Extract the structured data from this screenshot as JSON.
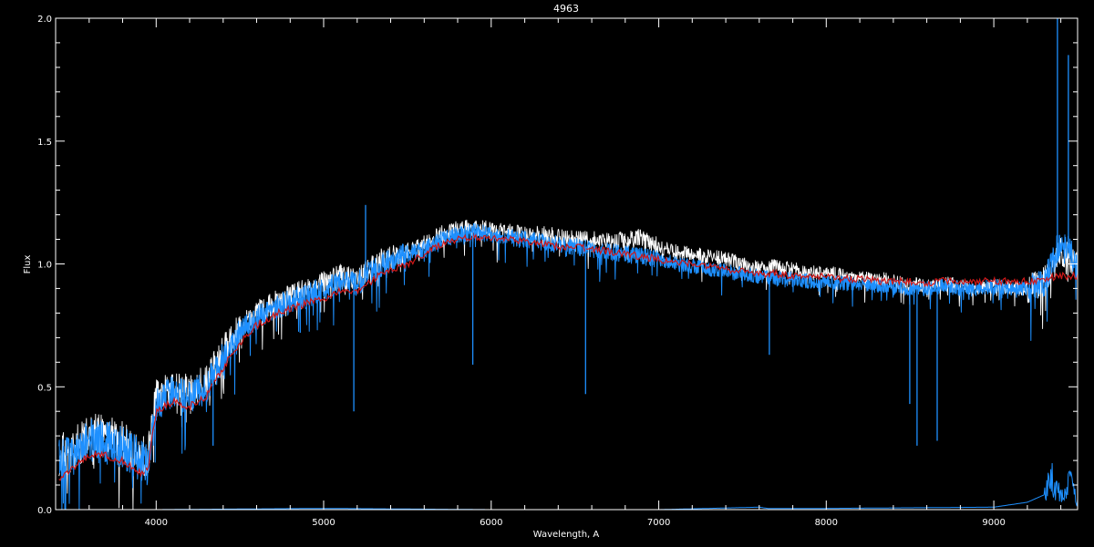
{
  "chart_data": {
    "type": "line",
    "title": "4963",
    "xlabel": "Wavelength, A",
    "ylabel": "Flux",
    "xlim": [
      3400,
      9500
    ],
    "ylim": [
      0.0,
      2.0
    ],
    "xticks": [
      4000,
      5000,
      6000,
      7000,
      8000,
      9000
    ],
    "xtick_labels": [
      "4000",
      "5000",
      "6000",
      "7000",
      "8000",
      "9000"
    ],
    "yticks": [
      0.0,
      0.5,
      1.0,
      1.5,
      2.0
    ],
    "ytick_labels": [
      "0.0",
      "0.5",
      "1.0",
      "1.5",
      "2.0"
    ],
    "grid": false,
    "background": "#000000",
    "series": [
      {
        "color": "#ffffff",
        "style": "spectrum-white",
        "x": [
          3420,
          3500,
          3600,
          3700,
          3800,
          3900,
          3950,
          4000,
          4100,
          4200,
          4300,
          4400,
          4500,
          4600,
          4700,
          4800,
          4900,
          5000,
          5100,
          5200,
          5300,
          5400,
          5500,
          5600,
          5700,
          5800,
          5900,
          6000,
          6100,
          6200,
          6300,
          6400,
          6500,
          6600,
          6700,
          6800,
          6900,
          7000,
          7100,
          7200,
          7300,
          7400,
          7500,
          7600,
          7700,
          7800,
          7900,
          8000,
          8100,
          8200,
          8300,
          8400,
          8500,
          8600,
          8700,
          8800,
          8900,
          9000,
          9100,
          9200,
          9300,
          9400,
          9500
        ],
        "values": [
          0.22,
          0.24,
          0.3,
          0.3,
          0.28,
          0.22,
          0.2,
          0.46,
          0.5,
          0.48,
          0.52,
          0.64,
          0.74,
          0.8,
          0.84,
          0.87,
          0.89,
          0.92,
          0.95,
          0.93,
          1.0,
          1.03,
          1.05,
          1.08,
          1.12,
          1.14,
          1.15,
          1.14,
          1.13,
          1.12,
          1.12,
          1.11,
          1.1,
          1.1,
          1.09,
          1.1,
          1.11,
          1.07,
          1.05,
          1.04,
          1.03,
          1.02,
          1.0,
          0.98,
          0.99,
          0.98,
          0.96,
          0.97,
          0.95,
          0.94,
          0.94,
          0.93,
          0.92,
          0.91,
          0.92,
          0.91,
          0.9,
          0.91,
          0.9,
          0.9,
          0.93,
          1.05,
          1.0
        ]
      },
      {
        "color": "#1e90ff",
        "style": "spectrum-blue",
        "x": [
          3420,
          3500,
          3600,
          3700,
          3800,
          3900,
          3950,
          4000,
          4100,
          4200,
          4300,
          4400,
          4500,
          4600,
          4700,
          4800,
          4900,
          5000,
          5100,
          5200,
          5300,
          5400,
          5500,
          5600,
          5700,
          5800,
          5900,
          6000,
          6100,
          6200,
          6300,
          6400,
          6500,
          6600,
          6700,
          6800,
          6900,
          7000,
          7100,
          7200,
          7300,
          7400,
          7500,
          7600,
          7700,
          7800,
          7900,
          8000,
          8100,
          8200,
          8300,
          8400,
          8500,
          8600,
          8700,
          8800,
          8900,
          9000,
          9100,
          9200,
          9300,
          9400,
          9500
        ],
        "values": [
          0.2,
          0.22,
          0.28,
          0.27,
          0.26,
          0.2,
          0.18,
          0.43,
          0.48,
          0.46,
          0.5,
          0.62,
          0.72,
          0.78,
          0.82,
          0.85,
          0.87,
          0.9,
          0.93,
          0.92,
          0.98,
          1.01,
          1.04,
          1.06,
          1.1,
          1.12,
          1.13,
          1.12,
          1.11,
          1.1,
          1.09,
          1.08,
          1.07,
          1.06,
          1.05,
          1.04,
          1.03,
          1.02,
          1.0,
          0.99,
          0.98,
          0.97,
          0.96,
          0.95,
          0.94,
          0.94,
          0.93,
          0.93,
          0.92,
          0.92,
          0.91,
          0.91,
          0.9,
          0.9,
          0.91,
          0.9,
          0.9,
          0.91,
          0.9,
          0.9,
          0.92,
          1.1,
          1.0
        ]
      },
      {
        "color": "#d01818",
        "style": "model",
        "x": [
          3420,
          3500,
          3600,
          3700,
          3800,
          3900,
          3950,
          4000,
          4100,
          4200,
          4300,
          4400,
          4500,
          4600,
          4700,
          4800,
          4900,
          5000,
          5100,
          5200,
          5300,
          5400,
          5500,
          5600,
          5700,
          5800,
          5900,
          6000,
          6100,
          6200,
          6300,
          6400,
          6500,
          6600,
          6700,
          6800,
          6900,
          7000,
          7100,
          7200,
          7300,
          7400,
          7500,
          7600,
          7700,
          7800,
          7900,
          8000,
          8100,
          8200,
          8300,
          8400,
          8500,
          8600,
          8700,
          8800,
          8900,
          9000,
          9100,
          9200,
          9300,
          9400,
          9500
        ],
        "values": [
          0.12,
          0.17,
          0.22,
          0.22,
          0.2,
          0.15,
          0.16,
          0.4,
          0.44,
          0.42,
          0.46,
          0.58,
          0.68,
          0.75,
          0.79,
          0.82,
          0.84,
          0.86,
          0.89,
          0.88,
          0.94,
          0.98,
          1.0,
          1.04,
          1.08,
          1.1,
          1.11,
          1.11,
          1.1,
          1.09,
          1.08,
          1.07,
          1.07,
          1.06,
          1.05,
          1.04,
          1.03,
          1.02,
          1.01,
          1.0,
          0.99,
          0.98,
          0.97,
          0.96,
          0.96,
          0.95,
          0.95,
          0.95,
          0.94,
          0.94,
          0.93,
          0.93,
          0.93,
          0.92,
          0.93,
          0.93,
          0.93,
          0.93,
          0.93,
          0.93,
          0.94,
          0.95,
          0.95
        ]
      },
      {
        "color": "#1e90ff",
        "style": "error-baseline",
        "x": [
          3420,
          4000,
          5000,
          6000,
          7000,
          7600,
          7650,
          8000,
          9000,
          9200,
          9300,
          9350,
          9400,
          9450,
          9500
        ],
        "values": [
          0.0,
          0.0,
          0.005,
          0.0,
          0.0,
          0.01,
          0.005,
          0.005,
          0.01,
          0.03,
          0.06,
          0.13,
          0.05,
          0.12,
          0.03
        ]
      }
    ],
    "absorption_lines": [
      {
        "x": 3935,
        "y": 0.12
      },
      {
        "x": 4340,
        "y": 0.26
      },
      {
        "x": 4860,
        "y": 0.72
      },
      {
        "x": 5180,
        "y": 0.4
      },
      {
        "x": 5250,
        "y": 1.24
      },
      {
        "x": 5890,
        "y": 0.59
      },
      {
        "x": 6563,
        "y": 0.47
      },
      {
        "x": 7660,
        "y": 0.63
      },
      {
        "x": 8498,
        "y": 0.43
      },
      {
        "x": 8542,
        "y": 0.26
      },
      {
        "x": 8662,
        "y": 0.28
      },
      {
        "x": 9380,
        "y": 2.0
      },
      {
        "x": 9445,
        "y": 1.85
      }
    ]
  }
}
